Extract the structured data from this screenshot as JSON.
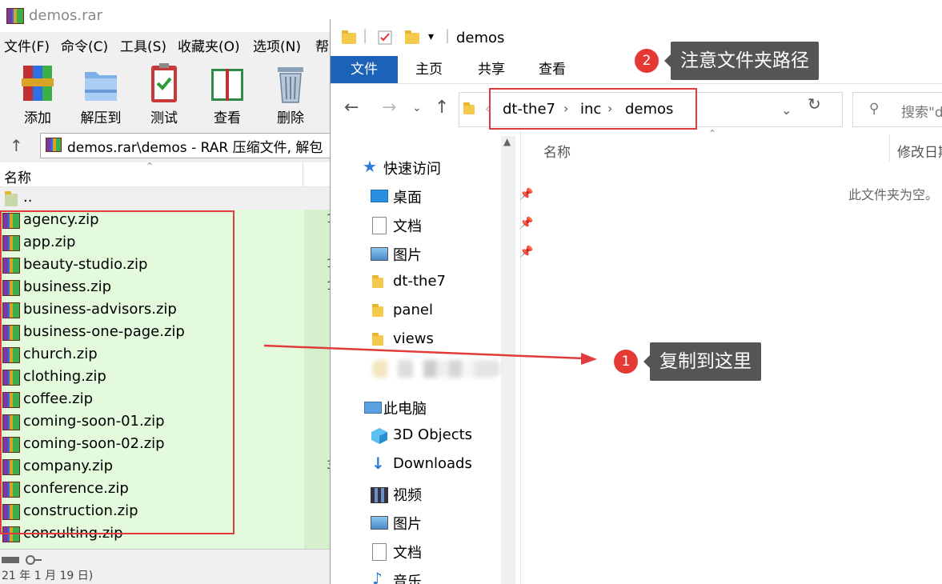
{
  "rar": {
    "title": "demos.rar",
    "menu": [
      "文件(F)",
      "命令(C)",
      "工具(S)",
      "收藏夹(O)",
      "选项(N)",
      "帮"
    ],
    "toolbar": [
      "添加",
      "解压到",
      "测试",
      "查看",
      "删除"
    ],
    "address": "demos.rar\\demos - RAR 压缩文件, 解包",
    "column_name": "名称",
    "parent_entry": "..",
    "files": [
      {
        "name": "agency.zip",
        "size": "1"
      },
      {
        "name": "app.zip",
        "size": ""
      },
      {
        "name": "beauty-studio.zip",
        "size": "1"
      },
      {
        "name": "business.zip",
        "size": "1"
      },
      {
        "name": "business-advisors.zip",
        "size": ""
      },
      {
        "name": "business-one-page.zip",
        "size": ""
      },
      {
        "name": "church.zip",
        "size": ""
      },
      {
        "name": "clothing.zip",
        "size": ""
      },
      {
        "name": "coffee.zip",
        "size": ""
      },
      {
        "name": "coming-soon-01.zip",
        "size": ""
      },
      {
        "name": "coming-soon-02.zip",
        "size": ""
      },
      {
        "name": "company.zip",
        "size": "3"
      },
      {
        "name": "conference.zip",
        "size": ""
      },
      {
        "name": "construction.zip",
        "size": ""
      },
      {
        "name": "consulting.zip",
        "size": ""
      }
    ],
    "status": "21 年 1 月 19 日)"
  },
  "explorer": {
    "title": "demos",
    "tabs": [
      "文件",
      "主页",
      "共享",
      "查看"
    ],
    "breadcrumb": [
      "dt-the7",
      "inc",
      "demos"
    ],
    "search_placeholder": "搜索\"d",
    "col_name": "名称",
    "col_modified": "修改日期",
    "empty_text": "此文件夹为空。",
    "quick_access": "快速访问",
    "quick_items": [
      "桌面",
      "文档",
      "图片",
      "dt-the7",
      "panel",
      "views"
    ],
    "this_pc": "此电脑",
    "pc_items": [
      "3D Objects",
      "Downloads",
      "视频",
      "图片",
      "文档",
      "音乐"
    ]
  },
  "annotations": {
    "badge1": "1",
    "callout1": "复制到这里",
    "badge2": "2",
    "callout2": "注意文件夹路径"
  },
  "colors": {
    "accent": "#1c62b8",
    "annotation_red": "#e23b3b",
    "list_bg": "#e3fbdc"
  }
}
